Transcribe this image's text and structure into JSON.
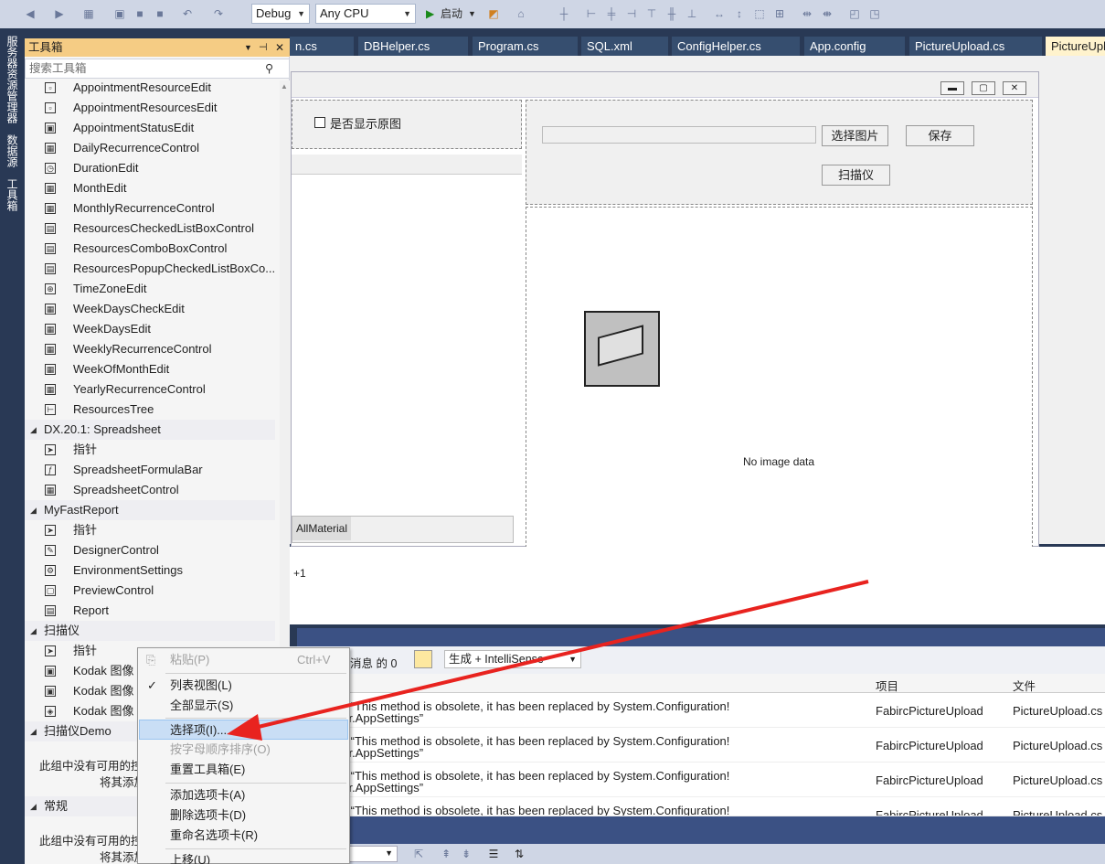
{
  "toolbar": {
    "config": "Debug",
    "platform": "Any CPU",
    "start_label": "启动"
  },
  "left_strip": {
    "tabs": [
      "服务器资源管理器",
      "数据源",
      "工具箱"
    ]
  },
  "toolbox": {
    "title": "工具箱",
    "search_placeholder": "搜索工具箱",
    "items_a": [
      "AppointmentResourceEdit",
      "AppointmentResourcesEdit",
      "AppointmentStatusEdit",
      "DailyRecurrenceControl",
      "DurationEdit",
      "MonthEdit",
      "MonthlyRecurrenceControl",
      "ResourcesCheckedListBoxControl",
      "ResourcesComboBoxControl",
      "ResourcesPopupCheckedListBoxCo...",
      "TimeZoneEdit",
      "WeekDaysCheckEdit",
      "WeekDaysEdit",
      "WeeklyRecurrenceControl",
      "WeekOfMonthEdit",
      "YearlyRecurrenceControl",
      "ResourcesTree"
    ],
    "group_spreadsheet": "DX.20.1: Spreadsheet",
    "items_spreadsheet": [
      "指针",
      "SpreadsheetFormulaBar",
      "SpreadsheetControl"
    ],
    "group_fastreport": "MyFastReport",
    "items_fastreport": [
      "指针",
      "DesignerControl",
      "EnvironmentSettings",
      "PreviewControl",
      "Report"
    ],
    "group_scanner": "扫描仪",
    "items_scanner": [
      "指针",
      "Kodak 图像",
      "Kodak 图像",
      "Kodak 图像"
    ],
    "group_scanner_demo": "扫描仪Demo",
    "empty_text_1": "此组中没有可用的控",
    "empty_text_2": "将其添加",
    "group_general": "常规",
    "empty_text_3": "此组中没有可用的控",
    "empty_text_4": "将其添加"
  },
  "tabs": [
    {
      "label": "n.cs"
    },
    {
      "label": "DBHelper.cs"
    },
    {
      "label": "Program.cs"
    },
    {
      "label": "SQL.xml"
    },
    {
      "label": "ConfigHelper.cs"
    },
    {
      "label": "App.config"
    },
    {
      "label": "PictureUpload.cs"
    },
    {
      "label": "PictureUpl"
    }
  ],
  "form": {
    "checkbox_label": "是否显示原图",
    "select_image": "选择图片",
    "save": "保存",
    "scanner": "扫描仪",
    "no_image": "No image data",
    "tab_label": "AllMaterial"
  },
  "output": {
    "line": "+1"
  },
  "error_list": {
    "messages_label": "消息 的 0",
    "build_filter": "生成 + IntelliSense",
    "col_project": "项目",
    "col_file": "文件",
    "rows": [
      {
        "line1": "过:“This method is obsolete, it has been replaced by System.Configuration!",
        "line2": "ger.AppSettings”",
        "project": "FabircPictureUpload",
        "file": "PictureUpload.cs"
      },
      {
        "line1": "过:“This method is obsolete, it has been replaced by System.Configuration!",
        "line2": "ger.AppSettings”",
        "project": "FabircPictureUpload",
        "file": "PictureUpload.cs"
      },
      {
        "line1": "过:“This method is obsolete, it has been replaced by System.Configuration!",
        "line2": "ger.AppSettings”",
        "project": "FabircPictureUpload",
        "file": "PictureUpload.cs"
      },
      {
        "line1": "过:“This method is obsolete, it has been replaced by System.Configuration!",
        "line2": "",
        "project": "FabircPictureUpload",
        "file": "PictureUpload.cs"
      }
    ]
  },
  "context_menu": {
    "paste": "粘贴(P)",
    "paste_shortcut": "Ctrl+V",
    "list_view": "列表视图(L)",
    "show_all": "全部显示(S)",
    "choose_items": "选择项(I)...",
    "sort_alpha": "按字母顺序排序(O)",
    "reset_toolbox": "重置工具箱(E)",
    "add_tab": "添加选项卡(A)",
    "delete_tab": "删除选项卡(D)",
    "rename_tab": "重命名选项卡(R)",
    "move_up": "上移(U)"
  },
  "colors": {
    "accent_highlight": "#f5cc84",
    "arrow": "#e8231f",
    "ide_dark": "#293955"
  }
}
